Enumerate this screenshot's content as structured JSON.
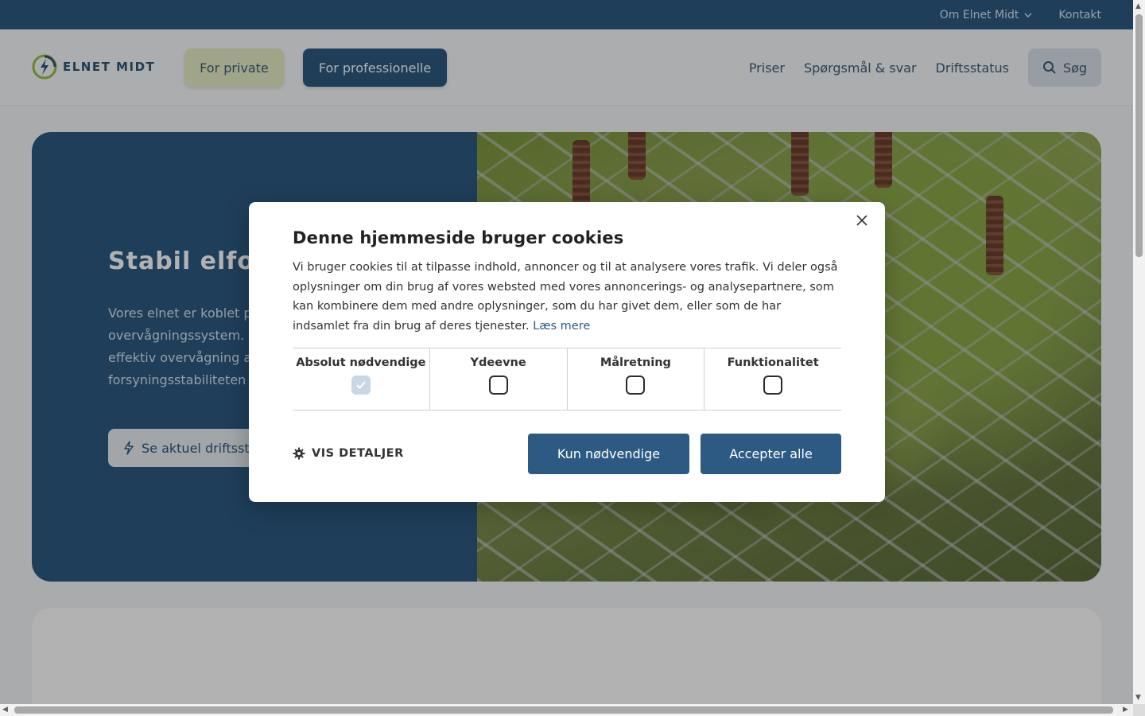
{
  "topbar": {
    "about": "Om Elnet Midt",
    "contact": "Kontakt"
  },
  "header": {
    "logo_text": "ELNET MIDT",
    "private_btn": "For private",
    "pro_btn": "For professionelle",
    "nav": [
      "Priser",
      "Spørgsmål & svar",
      "Driftsstatus"
    ],
    "search_btn": "Søg"
  },
  "hero": {
    "title": "Stabil elforsyning",
    "text": "Vores elnet er koblet på et avanceret overvågningssystem. Det sikrer os en hurtig og effektiv overvågning af nettet, så forsyningsstabiliteten er i top.",
    "button": "Se aktuel driftsstatus"
  },
  "cookie": {
    "title": "Denne hjemmeside bruger cookies",
    "body": "Vi bruger cookies til at tilpasse indhold, annoncer og til at analysere vores trafik. Vi deler også oplysninger om din brug af vores websted med vores annoncerings- og analysepartnere, som kan kombinere dem med andre oplysninger, som du har givet dem, eller som de har indsamlet fra din brug af deres tjenester.",
    "read_more": "Læs mere",
    "categories": [
      {
        "label": "Absolut nødvendige",
        "checked": true
      },
      {
        "label": "Ydeevne",
        "checked": false
      },
      {
        "label": "Målretning",
        "checked": false
      },
      {
        "label": "Funktionalitet",
        "checked": false
      }
    ],
    "details": "VIS DETALJER",
    "btn_necessary": "Kun nødvendige",
    "btn_accept": "Accepter alle"
  },
  "colors": {
    "brand": "#2d5a82",
    "accent": "#e6ecc4"
  }
}
